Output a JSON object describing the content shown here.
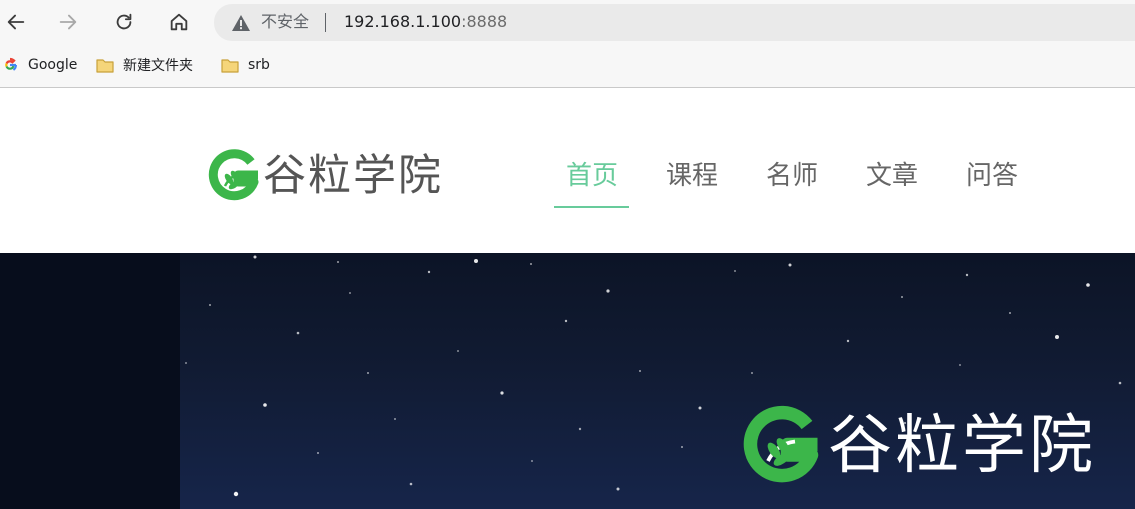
{
  "browser": {
    "back_icon": "arrow-left-icon",
    "forward_icon": "arrow-right-icon",
    "reload_icon": "reload-icon",
    "home_icon": "home-icon",
    "security_label": "不安全",
    "url_host": "192.168.1.100",
    "url_port": ":8888"
  },
  "bookmarks": [
    {
      "label": "Google",
      "icon": "google-icon"
    },
    {
      "label": "新建文件夹",
      "icon": "folder-icon"
    },
    {
      "label": "srb",
      "icon": "folder-icon"
    }
  ],
  "site": {
    "logo_text": "谷粒学院",
    "nav": [
      {
        "label": "首页",
        "active": true
      },
      {
        "label": "课程",
        "active": false
      },
      {
        "label": "名师",
        "active": false
      },
      {
        "label": "文章",
        "active": false
      },
      {
        "label": "问答",
        "active": false
      }
    ],
    "accent_color": "#68cb9b",
    "brand_green": "#3cb64a"
  },
  "hero": {
    "logo_text": "谷粒学院"
  }
}
